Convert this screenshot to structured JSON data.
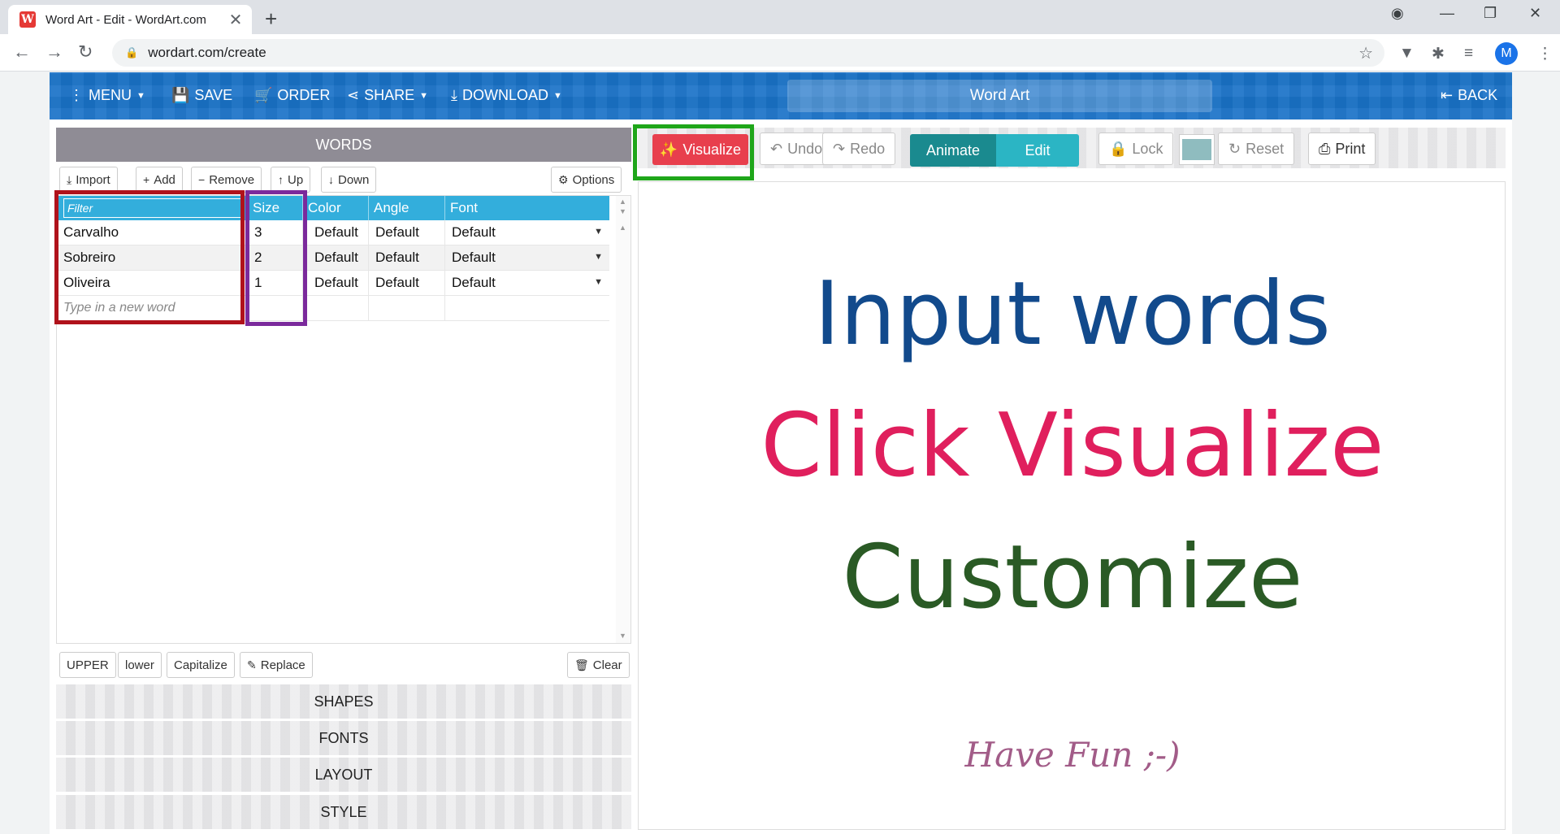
{
  "browser": {
    "tab_title": "Word Art - Edit - WordArt.com",
    "tab_icon": "W",
    "url": "wordart.com/create",
    "profile_initial": "M"
  },
  "topbar": {
    "menu": "MENU",
    "save": "SAVE",
    "order": "ORDER",
    "share": "SHARE",
    "download": "DOWNLOAD",
    "title": "Word Art",
    "back": "BACK"
  },
  "words_panel": {
    "header": "WORDS",
    "buttons": {
      "import": "Import",
      "add": "Add",
      "remove": "Remove",
      "up": "Up",
      "down": "Down",
      "options": "Options"
    },
    "columns": {
      "filter": "Filter",
      "size": "Size",
      "color": "Color",
      "angle": "Angle",
      "font": "Font"
    },
    "rows": [
      {
        "word": "Carvalho",
        "size": "3",
        "color": "Default",
        "angle": "Default",
        "font": "Default"
      },
      {
        "word": "Sobreiro",
        "size": "2",
        "color": "Default",
        "angle": "Default",
        "font": "Default"
      },
      {
        "word": "Oliveira",
        "size": "1",
        "color": "Default",
        "angle": "Default",
        "font": "Default"
      }
    ],
    "new_word_placeholder": "Type in a new word",
    "bottom_buttons": {
      "upper": "UPPER",
      "lower": "lower",
      "capitalize": "Capitalize",
      "replace": "Replace",
      "clear": "Clear"
    }
  },
  "accordion": {
    "shapes": "SHAPES",
    "fonts": "FONTS",
    "layout": "LAYOUT",
    "style": "STYLE"
  },
  "right_toolbar": {
    "visualize": "Visualize",
    "undo": "Undo",
    "redo": "Redo",
    "animate": "Animate",
    "edit": "Edit",
    "lock": "Lock",
    "reset": "Reset",
    "print": "Print",
    "swatch_color": "#8fbcbf"
  },
  "canvas": {
    "line1": "Input words",
    "line2": "Click Visualize",
    "line3": "Customize",
    "line4": "Have Fun ;-)"
  },
  "colors": {
    "topbar": "#1a73c8",
    "visualize": "#e83f4d",
    "highlight_words": "#b0121b",
    "highlight_size": "#7b2a9c",
    "highlight_visualize": "#1fa61a"
  }
}
